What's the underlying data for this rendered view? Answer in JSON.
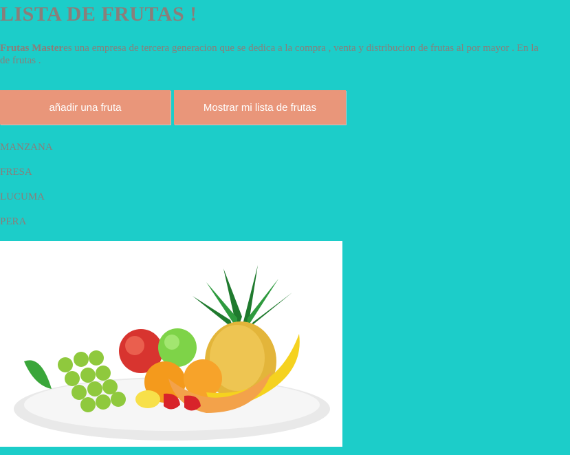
{
  "header": {
    "title": "LISTA DE FRUTAS !"
  },
  "intro": {
    "brand": "Frutas Master",
    "line1_rest": "es una empresa de tercera generacion que se dedica a la compra , venta y distribucion de frutas al por mayor . En la",
    "line2": "de frutas ."
  },
  "actions": {
    "add_label": "añadir una fruta",
    "show_label": "Mostrar mi lista de frutas"
  },
  "fruits": [
    "MANZANA",
    "FRESA",
    "LUCUMA",
    "PERA"
  ],
  "image": {
    "icon": "fruit-plate-illustration"
  },
  "colors": {
    "background": "#1ccdc9",
    "button": "#e9967a",
    "text": "#8a7e7a"
  }
}
